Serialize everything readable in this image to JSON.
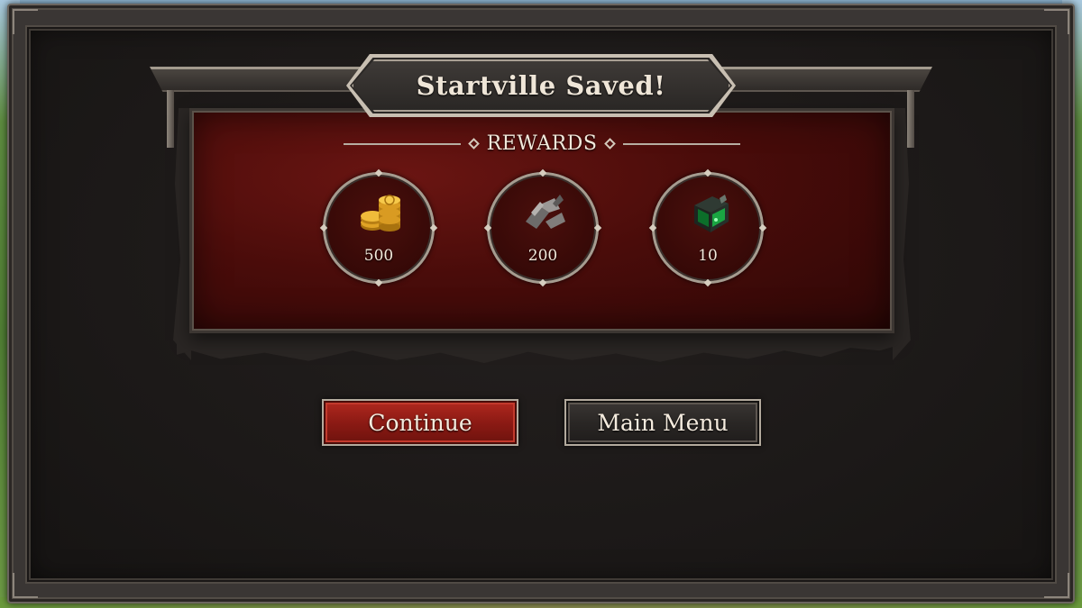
{
  "dialog": {
    "title": "Startville Saved!"
  },
  "rewards": {
    "header": "REWARDS",
    "items": [
      {
        "icon": "gold-coins-icon",
        "amount": "500"
      },
      {
        "icon": "iron-scraps-icon",
        "amount": "200"
      },
      {
        "icon": "green-gem-chest-icon",
        "amount": "10"
      }
    ]
  },
  "buttons": {
    "continue_label": "Continue",
    "main_menu_label": "Main Menu"
  },
  "colors": {
    "panel_red": "#4a0c0a",
    "continue_red": "#8c1a14",
    "frame_dark": "#1c1918",
    "text_light": "#f1e8da"
  }
}
